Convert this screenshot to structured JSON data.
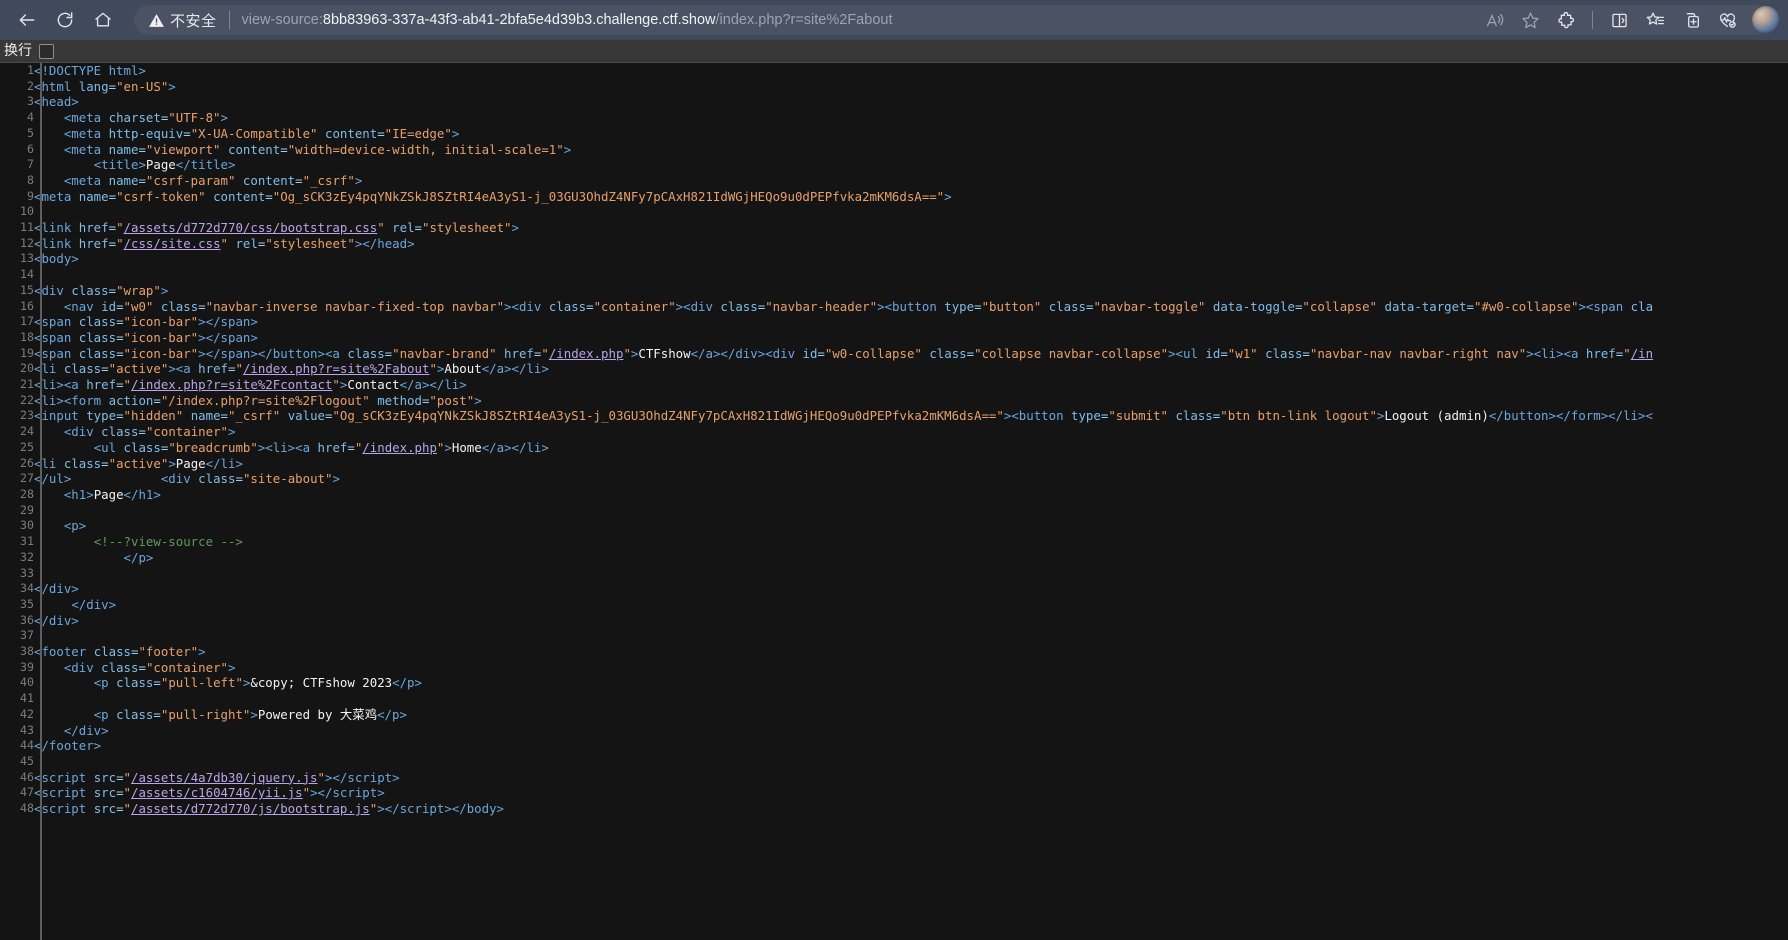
{
  "browser": {
    "back_label": "back-arrow",
    "reload_label": "reload",
    "home_label": "home",
    "security_text": "不安全",
    "url_prefix": "view-source:",
    "url_host": "8bb83963-337a-43f3-ab41-2bfa5e4d39b3.challenge.ctf.show",
    "url_path": "/index.php?r=site%2Fabout",
    "icons": [
      "read-aloud-icon",
      "favorite-star-icon",
      "extensions-icon",
      "split-screen-icon",
      "collections-icon",
      "browser-essentials-icon",
      "add-tab-icon",
      "profile-avatar"
    ]
  },
  "viewsource": {
    "wrap_label": "换行",
    "wrap_checked": false
  },
  "code": {
    "lines": [
      {
        "n": 1,
        "html": "<span class=\"tag\">&lt;!DOCTYPE html&gt;</span>"
      },
      {
        "n": 2,
        "html": "<span class=\"tag\">&lt;html </span><span class=\"attr\">lang</span><span class=\"eq\">=</span><span class=\"val\">\"en-US\"</span><span class=\"tag\">&gt;</span>"
      },
      {
        "n": 3,
        "html": "<span class=\"tag\">&lt;head&gt;</span>"
      },
      {
        "n": 4,
        "html": "    <span class=\"tag\">&lt;meta </span><span class=\"attr\">charset</span><span class=\"eq\">=</span><span class=\"val\">\"UTF-8\"</span><span class=\"tag\">&gt;</span>"
      },
      {
        "n": 5,
        "html": "    <span class=\"tag\">&lt;meta </span><span class=\"attr\">http-equiv</span><span class=\"eq\">=</span><span class=\"val\">\"X-UA-Compatible\"</span> <span class=\"attr\">content</span><span class=\"eq\">=</span><span class=\"val\">\"IE=edge\"</span><span class=\"tag\">&gt;</span>"
      },
      {
        "n": 6,
        "html": "    <span class=\"tag\">&lt;meta </span><span class=\"attr\">name</span><span class=\"eq\">=</span><span class=\"val\">\"viewport\"</span> <span class=\"attr\">content</span><span class=\"eq\">=</span><span class=\"val\">\"width=device-width, initial-scale=1\"</span><span class=\"tag\">&gt;</span>"
      },
      {
        "n": 7,
        "html": "        <span class=\"tag\">&lt;title&gt;</span><span class=\"txt\">Page</span><span class=\"tag\">&lt;/title&gt;</span>"
      },
      {
        "n": 8,
        "html": "    <span class=\"tag\">&lt;meta </span><span class=\"attr\">name</span><span class=\"eq\">=</span><span class=\"val\">\"csrf-param\"</span> <span class=\"attr\">content</span><span class=\"eq\">=</span><span class=\"val\">\"_csrf\"</span><span class=\"tag\">&gt;</span>"
      },
      {
        "n": 9,
        "html": "<span class=\"tag\">&lt;meta </span><span class=\"attr\">name</span><span class=\"eq\">=</span><span class=\"val\">\"csrf-token\"</span> <span class=\"attr\">content</span><span class=\"eq\">=</span><span class=\"val\">\"Og_sCK3zEy4pqYNkZSkJ8SZtRI4eA3yS1-j_03GU3OhdZ4NFy7pCAxH821IdWGjHEQo9u0dPEPfvka2mKM6dsA==\"</span><span class=\"tag\">&gt;</span>"
      },
      {
        "n": 10,
        "html": ""
      },
      {
        "n": 11,
        "html": "<span class=\"tag\">&lt;link </span><span class=\"attr\">href</span><span class=\"eq\">=</span><span class=\"val\">\"</span><span class=\"lnk\">/assets/d772d770/css/bootstrap.css</span><span class=\"val\">\"</span> <span class=\"attr\">rel</span><span class=\"eq\">=</span><span class=\"val\">\"stylesheet\"</span><span class=\"tag\">&gt;</span>"
      },
      {
        "n": 12,
        "html": "<span class=\"tag\">&lt;link </span><span class=\"attr\">href</span><span class=\"eq\">=</span><span class=\"val\">\"</span><span class=\"lnk\">/css/site.css</span><span class=\"val\">\"</span> <span class=\"attr\">rel</span><span class=\"eq\">=</span><span class=\"val\">\"stylesheet\"</span><span class=\"tag\">&gt;&lt;/head&gt;</span>"
      },
      {
        "n": 13,
        "html": "<span class=\"tag\">&lt;body&gt;</span>"
      },
      {
        "n": 14,
        "html": ""
      },
      {
        "n": 15,
        "html": "<span class=\"tag\">&lt;div </span><span class=\"attr\">class</span><span class=\"eq\">=</span><span class=\"val\">\"wrap\"</span><span class=\"tag\">&gt;</span>"
      },
      {
        "n": 16,
        "html": "    <span class=\"tag\">&lt;nav </span><span class=\"attr\">id</span><span class=\"eq\">=</span><span class=\"val\">\"w0\"</span> <span class=\"attr\">class</span><span class=\"eq\">=</span><span class=\"val\">\"navbar-inverse navbar-fixed-top navbar\"</span><span class=\"tag\">&gt;&lt;div </span><span class=\"attr\">class</span><span class=\"eq\">=</span><span class=\"val\">\"container\"</span><span class=\"tag\">&gt;&lt;div </span><span class=\"attr\">class</span><span class=\"eq\">=</span><span class=\"val\">\"navbar-header\"</span><span class=\"tag\">&gt;&lt;button </span><span class=\"attr\">type</span><span class=\"eq\">=</span><span class=\"val\">\"button\"</span> <span class=\"attr\">class</span><span class=\"eq\">=</span><span class=\"val\">\"navbar-toggle\"</span> <span class=\"attr\">data-toggle</span><span class=\"eq\">=</span><span class=\"val\">\"collapse\"</span> <span class=\"attr\">data-target</span><span class=\"eq\">=</span><span class=\"val\">\"#w0-collapse\"</span><span class=\"tag\">&gt;&lt;span </span><span class=\"attr\">cla</span>"
      },
      {
        "n": 17,
        "html": "<span class=\"tag\">&lt;span </span><span class=\"attr\">class</span><span class=\"eq\">=</span><span class=\"val\">\"icon-bar\"</span><span class=\"tag\">&gt;&lt;/span&gt;</span>"
      },
      {
        "n": 18,
        "html": "<span class=\"tag\">&lt;span </span><span class=\"attr\">class</span><span class=\"eq\">=</span><span class=\"val\">\"icon-bar\"</span><span class=\"tag\">&gt;&lt;/span&gt;</span>"
      },
      {
        "n": 19,
        "html": "<span class=\"tag\">&lt;span </span><span class=\"attr\">class</span><span class=\"eq\">=</span><span class=\"val\">\"icon-bar\"</span><span class=\"tag\">&gt;&lt;/span&gt;&lt;/button&gt;&lt;a </span><span class=\"attr\">class</span><span class=\"eq\">=</span><span class=\"val\">\"navbar-brand\"</span> <span class=\"attr\">href</span><span class=\"eq\">=</span><span class=\"val\">\"</span><span class=\"lnk\">/index.php</span><span class=\"val\">\"</span><span class=\"tag\">&gt;</span><span class=\"txt\">CTFshow</span><span class=\"tag\">&lt;/a&gt;&lt;/div&gt;&lt;div </span><span class=\"attr\">id</span><span class=\"eq\">=</span><span class=\"val\">\"w0-collapse\"</span> <span class=\"attr\">class</span><span class=\"eq\">=</span><span class=\"val\">\"collapse navbar-collapse\"</span><span class=\"tag\">&gt;&lt;ul </span><span class=\"attr\">id</span><span class=\"eq\">=</span><span class=\"val\">\"w1\"</span> <span class=\"attr\">class</span><span class=\"eq\">=</span><span class=\"val\">\"navbar-nav navbar-right nav\"</span><span class=\"tag\">&gt;&lt;li&gt;&lt;a </span><span class=\"attr\">href</span><span class=\"eq\">=</span><span class=\"val\">\"</span><span class=\"lnk\">/in</span>"
      },
      {
        "n": 20,
        "html": "<span class=\"tag\">&lt;li </span><span class=\"attr\">class</span><span class=\"eq\">=</span><span class=\"val\">\"active\"</span><span class=\"tag\">&gt;&lt;a </span><span class=\"attr\">href</span><span class=\"eq\">=</span><span class=\"val\">\"</span><span class=\"lnk\">/index.php?r=site%2Fabout</span><span class=\"val\">\"</span><span class=\"tag\">&gt;</span><span class=\"txt\">About</span><span class=\"tag\">&lt;/a&gt;&lt;/li&gt;</span>"
      },
      {
        "n": 21,
        "html": "<span class=\"tag\">&lt;li&gt;&lt;a </span><span class=\"attr\">href</span><span class=\"eq\">=</span><span class=\"val\">\"</span><span class=\"lnk\">/index.php?r=site%2Fcontact</span><span class=\"val\">\"</span><span class=\"tag\">&gt;</span><span class=\"txt\">Contact</span><span class=\"tag\">&lt;/a&gt;&lt;/li&gt;</span>"
      },
      {
        "n": 22,
        "html": "<span class=\"tag\">&lt;li&gt;&lt;form </span><span class=\"attr\">action</span><span class=\"eq\">=</span><span class=\"val\">\"/index.php?r=site%2Flogout\"</span> <span class=\"attr\">method</span><span class=\"eq\">=</span><span class=\"val\">\"post\"</span><span class=\"tag\">&gt;</span>"
      },
      {
        "n": 23,
        "html": "<span class=\"tag\">&lt;input </span><span class=\"attr\">type</span><span class=\"eq\">=</span><span class=\"val\">\"hidden\"</span> <span class=\"attr\">name</span><span class=\"eq\">=</span><span class=\"val\">\"_csrf\"</span> <span class=\"attr\">value</span><span class=\"eq\">=</span><span class=\"val\">\"Og_sCK3zEy4pqYNkZSkJ8SZtRI4eA3yS1-j_03GU3OhdZ4NFy7pCAxH821IdWGjHEQo9u0dPEPfvka2mKM6dsA==\"</span><span class=\"tag\">&gt;&lt;button </span><span class=\"attr\">type</span><span class=\"eq\">=</span><span class=\"val\">\"submit\"</span> <span class=\"attr\">class</span><span class=\"eq\">=</span><span class=\"val\">\"btn btn-link logout\"</span><span class=\"tag\">&gt;</span><span class=\"txt\">Logout (admin)</span><span class=\"tag\">&lt;/button&gt;&lt;/form&gt;&lt;/li&gt;&lt;</span>"
      },
      {
        "n": 24,
        "html": "    <span class=\"tag\">&lt;div </span><span class=\"attr\">class</span><span class=\"eq\">=</span><span class=\"val\">\"container\"</span><span class=\"tag\">&gt;</span>"
      },
      {
        "n": 25,
        "html": "        <span class=\"tag\">&lt;ul </span><span class=\"attr\">class</span><span class=\"eq\">=</span><span class=\"val\">\"breadcrumb\"</span><span class=\"tag\">&gt;&lt;li&gt;&lt;a </span><span class=\"attr\">href</span><span class=\"eq\">=</span><span class=\"val\">\"</span><span class=\"lnk\">/index.php</span><span class=\"val\">\"</span><span class=\"tag\">&gt;</span><span class=\"txt\">Home</span><span class=\"tag\">&lt;/a&gt;&lt;/li&gt;</span>"
      },
      {
        "n": 26,
        "html": "<span class=\"tag\">&lt;li </span><span class=\"attr\">class</span><span class=\"eq\">=</span><span class=\"val\">\"active\"</span><span class=\"tag\">&gt;</span><span class=\"txt\">Page</span><span class=\"tag\">&lt;/li&gt;</span>"
      },
      {
        "n": 27,
        "html": "<span class=\"tag\">&lt;/ul&gt;</span>            <span class=\"tag\">&lt;div </span><span class=\"attr\">class</span><span class=\"eq\">=</span><span class=\"val\">\"site-about\"</span><span class=\"tag\">&gt;</span>"
      },
      {
        "n": 28,
        "html": "    <span class=\"tag\">&lt;h1&gt;</span><span class=\"txt\">Page</span><span class=\"tag\">&lt;/h1&gt;</span>"
      },
      {
        "n": 29,
        "html": ""
      },
      {
        "n": 30,
        "html": "    <span class=\"tag\">&lt;p&gt;</span>"
      },
      {
        "n": 31,
        "html": "        <span class=\"cmt\">&lt;!--?view-source --&gt;</span>"
      },
      {
        "n": 32,
        "html": "            <span class=\"tag\">&lt;/p&gt;</span>"
      },
      {
        "n": 33,
        "html": ""
      },
      {
        "n": 34,
        "html": "<span class=\"tag\">&lt;/div&gt;</span>"
      },
      {
        "n": 35,
        "html": "     <span class=\"tag\">&lt;/div&gt;</span>"
      },
      {
        "n": 36,
        "html": "<span class=\"tag\">&lt;/div&gt;</span>"
      },
      {
        "n": 37,
        "html": ""
      },
      {
        "n": 38,
        "html": "<span class=\"tag\">&lt;footer </span><span class=\"attr\">class</span><span class=\"eq\">=</span><span class=\"val\">\"footer\"</span><span class=\"tag\">&gt;</span>"
      },
      {
        "n": 39,
        "html": "    <span class=\"tag\">&lt;div </span><span class=\"attr\">class</span><span class=\"eq\">=</span><span class=\"val\">\"container\"</span><span class=\"tag\">&gt;</span>"
      },
      {
        "n": 40,
        "html": "        <span class=\"tag\">&lt;p </span><span class=\"attr\">class</span><span class=\"eq\">=</span><span class=\"val\">\"pull-left\"</span><span class=\"tag\">&gt;</span><span class=\"txt\">&amp;copy; CTFshow 2023</span><span class=\"tag\">&lt;/p&gt;</span>"
      },
      {
        "n": 41,
        "html": ""
      },
      {
        "n": 42,
        "html": "        <span class=\"tag\">&lt;p </span><span class=\"attr\">class</span><span class=\"eq\">=</span><span class=\"val\">\"pull-right\"</span><span class=\"tag\">&gt;</span><span class=\"txt\">Powered by 大菜鸡</span><span class=\"tag\">&lt;/p&gt;</span>"
      },
      {
        "n": 43,
        "html": "    <span class=\"tag\">&lt;/div&gt;</span>"
      },
      {
        "n": 44,
        "html": "<span class=\"tag\">&lt;/footer&gt;</span>"
      },
      {
        "n": 45,
        "html": ""
      },
      {
        "n": 46,
        "html": "<span class=\"tag\">&lt;script </span><span class=\"attr\">src</span><span class=\"eq\">=</span><span class=\"val\">\"</span><span class=\"lnk\">/assets/4a7db30/jquery.js</span><span class=\"val\">\"</span><span class=\"tag\">&gt;&lt;/script&gt;</span>"
      },
      {
        "n": 47,
        "html": "<span class=\"tag\">&lt;script </span><span class=\"attr\">src</span><span class=\"eq\">=</span><span class=\"val\">\"</span><span class=\"lnk\">/assets/c1604746/yii.js</span><span class=\"val\">\"</span><span class=\"tag\">&gt;&lt;/script&gt;</span>"
      },
      {
        "n": 48,
        "html": "<span class=\"tag\">&lt;script </span><span class=\"attr\">src</span><span class=\"eq\">=</span><span class=\"val\">\"</span><span class=\"lnk\">/assets/d772d770/js/bootstrap.js</span><span class=\"val\">\"</span><span class=\"tag\">&gt;&lt;/script&gt;&lt;/body&gt;</span>"
      }
    ]
  }
}
